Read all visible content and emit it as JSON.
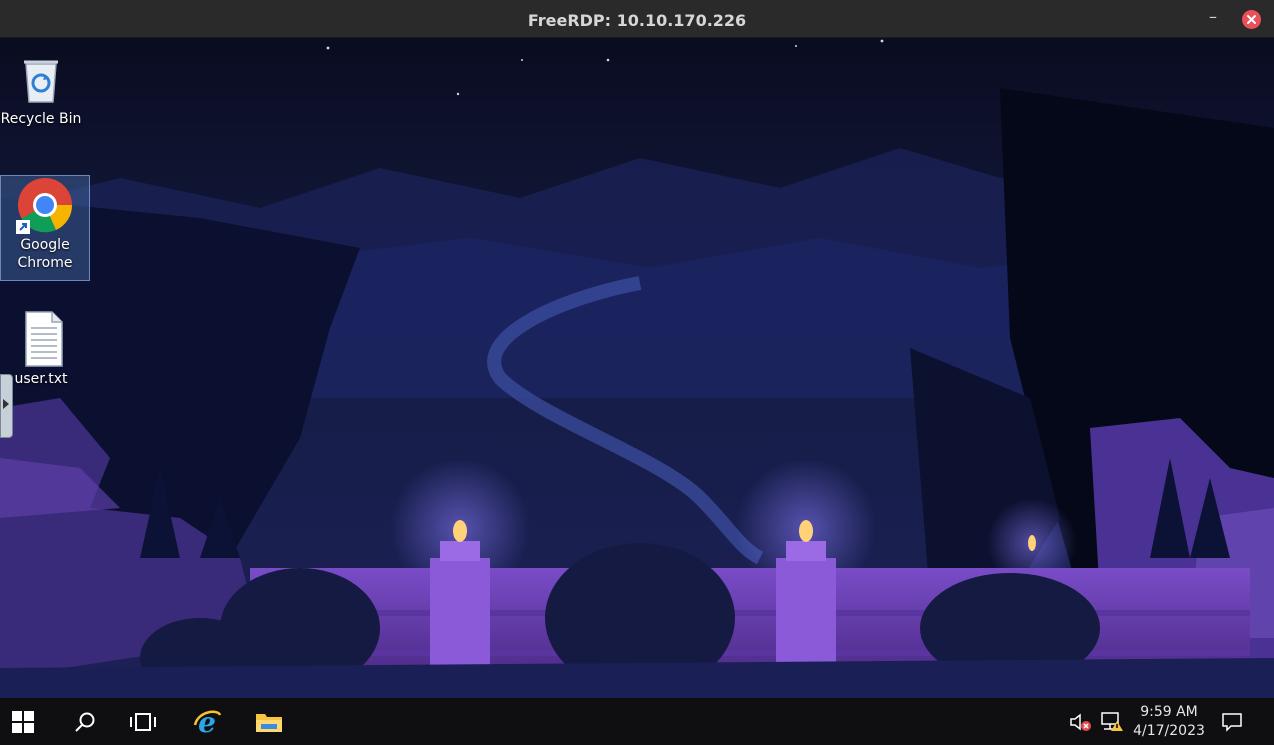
{
  "window": {
    "title": "FreeRDP: 10.10.170.226",
    "minimize_label": "–"
  },
  "desktop_icons": [
    {
      "label": "Recycle Bin",
      "icon": "recycle-bin-icon"
    },
    {
      "label": "Google Chrome",
      "icon": "chrome-icon"
    },
    {
      "label": "user.txt",
      "icon": "text-file-icon"
    }
  ],
  "taskbar": {
    "items": [
      "start-icon",
      "search-icon",
      "task-view-icon",
      "internet-explorer-icon",
      "file-explorer-icon"
    ],
    "tray": {
      "time": "9:59 AM",
      "date": "4/17/2023"
    }
  },
  "colors": {
    "titlebar": "#2a2a2a",
    "close": "#e9505a",
    "taskbar": "#0f0f12",
    "wall_top": "#0c0f24",
    "wall_purple": "#6a3fb5",
    "flame": "#ffd27a"
  }
}
